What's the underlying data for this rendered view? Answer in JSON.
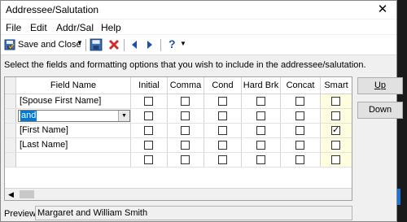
{
  "window": {
    "title": "Addressee/Salutation"
  },
  "menu": [
    "File",
    "Edit",
    "Addr/Sal",
    "Help"
  ],
  "toolbar": {
    "save_close_label": "Save and Close"
  },
  "instructions": "Select the fields and formatting options that you wish to include in the addressee/salutation.",
  "grid": {
    "columns": [
      "Field Name",
      "Initial",
      "Comma",
      "Cond",
      "Hard Brk",
      "Concat",
      "Smart"
    ],
    "rows": [
      {
        "name": "[Spouse First Name]",
        "checks": [
          false,
          false,
          false,
          false,
          false,
          false
        ]
      },
      {
        "name": "and",
        "editing": true,
        "checks": [
          false,
          false,
          false,
          false,
          false,
          false
        ]
      },
      {
        "name": "[First Name]",
        "checks": [
          false,
          false,
          false,
          false,
          false,
          true
        ]
      },
      {
        "name": "[Last Name]",
        "checks": [
          false,
          false,
          false,
          false,
          false,
          false
        ]
      },
      {
        "name": "",
        "checks": [
          false,
          false,
          false,
          false,
          false,
          false
        ]
      }
    ]
  },
  "buttons": {
    "up": "Up",
    "down": "Down"
  },
  "preview": {
    "label": "Preview:",
    "value": "Margaret and William Smith"
  },
  "colors": {
    "accent": "#0078d7",
    "smart_column_bg": "#fffde0"
  }
}
